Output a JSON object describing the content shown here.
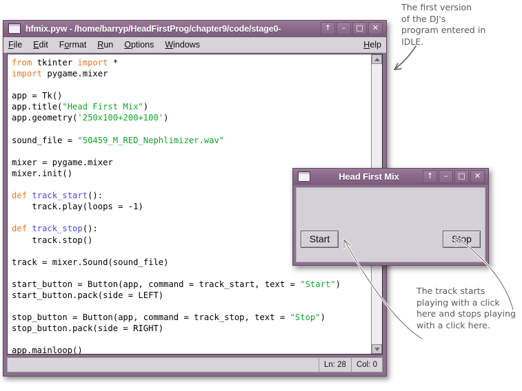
{
  "idle_window": {
    "title": "hfmix.pyw - /home/barryp/HeadFirstProg/chapter9/code/stage0-",
    "window_icon": "window-icon",
    "title_buttons": [
      {
        "name": "rollup-button",
        "glyph": "↑"
      },
      {
        "name": "minimize-button",
        "glyph": "–"
      },
      {
        "name": "maximize-button",
        "glyph": "□"
      },
      {
        "name": "close-button",
        "glyph": "✕"
      }
    ],
    "menus": [
      {
        "name": "menu-file",
        "pre": "",
        "accel": "F",
        "post": "ile"
      },
      {
        "name": "menu-edit",
        "pre": "",
        "accel": "E",
        "post": "dit"
      },
      {
        "name": "menu-format",
        "pre": "F",
        "accel": "o",
        "post": "rmat"
      },
      {
        "name": "menu-run",
        "pre": "",
        "accel": "R",
        "post": "un"
      },
      {
        "name": "menu-options",
        "pre": "",
        "accel": "O",
        "post": "ptions"
      },
      {
        "name": "menu-windows",
        "pre": "",
        "accel": "W",
        "post": "indows"
      }
    ],
    "help_menu": {
      "name": "menu-help",
      "pre": "",
      "accel": "H",
      "post": "elp"
    },
    "code_lines": [
      [
        {
          "t": "from",
          "c": "kw"
        },
        {
          "t": " tkinter ",
          "c": ""
        },
        {
          "t": "import",
          "c": "kw"
        },
        {
          "t": " *",
          "c": ""
        }
      ],
      [
        {
          "t": "import",
          "c": "kw"
        },
        {
          "t": " pygame.mixer",
          "c": ""
        }
      ],
      [],
      [
        {
          "t": "app = Tk()",
          "c": ""
        }
      ],
      [
        {
          "t": "app.title(",
          "c": ""
        },
        {
          "t": "\"Head First Mix\"",
          "c": "str"
        },
        {
          "t": ")",
          "c": ""
        }
      ],
      [
        {
          "t": "app.geometry(",
          "c": ""
        },
        {
          "t": "'250x100+200+100'",
          "c": "str"
        },
        {
          "t": ")",
          "c": ""
        }
      ],
      [],
      [
        {
          "t": "sound_file = ",
          "c": ""
        },
        {
          "t": "\"50459_M_RED_Nephlimizer.wav\"",
          "c": "str"
        }
      ],
      [],
      [
        {
          "t": "mixer = pygame.mixer",
          "c": ""
        }
      ],
      [
        {
          "t": "mixer.init()",
          "c": ""
        }
      ],
      [],
      [
        {
          "t": "def",
          "c": "kw"
        },
        {
          "t": " ",
          "c": ""
        },
        {
          "t": "track_start",
          "c": "fname"
        },
        {
          "t": "():",
          "c": ""
        }
      ],
      [
        {
          "t": "    track.play(loops = -1)",
          "c": ""
        }
      ],
      [],
      [
        {
          "t": "def",
          "c": "kw"
        },
        {
          "t": " ",
          "c": ""
        },
        {
          "t": "track_stop",
          "c": "fname"
        },
        {
          "t": "():",
          "c": ""
        }
      ],
      [
        {
          "t": "    track.stop()",
          "c": ""
        }
      ],
      [],
      [
        {
          "t": "track = mixer.Sound(sound_file)",
          "c": ""
        }
      ],
      [],
      [
        {
          "t": "start_button = Button(app, command = track_start, text = ",
          "c": ""
        },
        {
          "t": "\"Start\"",
          "c": "str"
        },
        {
          "t": ")",
          "c": ""
        }
      ],
      [
        {
          "t": "start_button.pack(side = LEFT)",
          "c": ""
        }
      ],
      [],
      [
        {
          "t": "stop_button = Button(app, command = track_stop, text = ",
          "c": ""
        },
        {
          "t": "\"Stop\"",
          "c": "str"
        },
        {
          "t": ")",
          "c": ""
        }
      ],
      [
        {
          "t": "stop_button.pack(side = RIGHT)",
          "c": ""
        }
      ],
      [],
      [
        {
          "t": "app.mainloop()",
          "c": ""
        }
      ],
      [
        {
          "t": "",
          "c": "caret"
        }
      ]
    ],
    "status": {
      "line": "Ln: 28",
      "column": "Col: 0"
    }
  },
  "mix_window": {
    "title": "Head First Mix",
    "window_icon": "window-icon",
    "title_buttons": [
      {
        "name": "rollup-button",
        "glyph": "↑"
      },
      {
        "name": "minimize-button",
        "glyph": "–"
      },
      {
        "name": "maximize-button",
        "glyph": "□"
      },
      {
        "name": "close-button",
        "glyph": "✕"
      }
    ],
    "start_button": "Start",
    "stop_button": "Stop"
  },
  "annotations": {
    "top": "The first version\nof the DJ's\nprogram entered in\nIDLE.",
    "bottom": "The track starts\nplaying with a click\nhere and stops playing\nwith a click here."
  },
  "colors": {
    "titlebar": "#8b6a8b",
    "window_frame": "#8d6e8d",
    "chrome": "#d4d0d7",
    "keyword": "#f07820",
    "string": "#12a52a",
    "function_name": "#4c4cdd",
    "annotation_ink": "#5d5a5c"
  }
}
